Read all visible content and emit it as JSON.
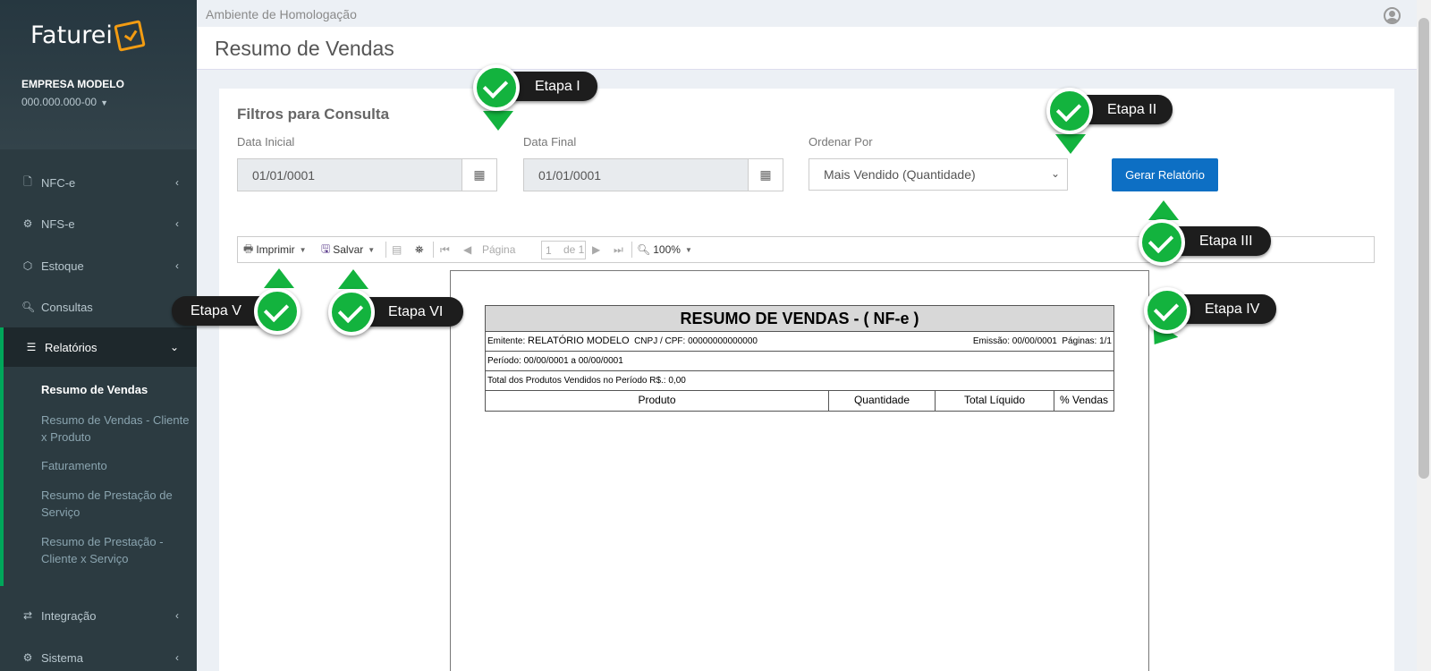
{
  "app": {
    "logo_text": "Faturei",
    "company": "EMPRESA MODELO",
    "cnpj": "000.000.000-00"
  },
  "sidebar": {
    "items": [
      {
        "label": "NFC-e",
        "icon": "file-icon"
      },
      {
        "label": "NFS-e",
        "icon": "cogs-icon"
      },
      {
        "label": "Estoque",
        "icon": "cube-icon"
      },
      {
        "label": "Consultas",
        "icon": "search-icon"
      },
      {
        "label": "Relatórios",
        "icon": "list-icon"
      },
      {
        "label": "Integração",
        "icon": "exchange-icon"
      },
      {
        "label": "Sistema",
        "icon": "cogs-icon"
      }
    ],
    "submenu": [
      "Resumo de Vendas",
      "Resumo de Vendas - Cliente x Produto",
      "Faturamento",
      "Resumo de Prestação de Serviço",
      "Resumo de Prestação - Cliente x Serviço"
    ]
  },
  "topbar": {
    "environment": "Ambiente de Homologação"
  },
  "header": {
    "title": "Resumo de Vendas"
  },
  "filters": {
    "title": "Filtros para Consulta",
    "start_label": "Data Inicial",
    "start_value": "01/01/0001",
    "end_label": "Data Final",
    "end_value": "01/01/0001",
    "order_label": "Ordenar Por",
    "order_value": "Mais Vendido (Quantidade)",
    "generate_label": "Gerar Relatório"
  },
  "toolbar": {
    "print": "Imprimir",
    "save": "Salvar",
    "page_label": "Página",
    "page_value": "1",
    "page_of": "de 1",
    "zoom": "100%"
  },
  "report": {
    "title": "RESUMO DE VENDAS - ( NF-e )",
    "emitente_label": "Emitente:",
    "emitente_value": "RELATÓRIO MODELO",
    "cnpj_label": "CNPJ / CPF:",
    "cnpj_value": "00000000000000",
    "emissao": "Emissão: 00/00/0001",
    "paginas": "Páginas: 1/1",
    "periodo": "Período: 00/00/0001 a 00/00/0001",
    "total": "Total dos Produtos Vendidos no Período R$.: 0,00",
    "columns": [
      "Produto",
      "Quantidade",
      "Total Líquido",
      "% Vendas"
    ]
  },
  "callouts": [
    "Etapa I",
    "Etapa II",
    "Etapa III",
    "Etapa IV",
    "Etapa V",
    "Etapa VI"
  ],
  "colors": {
    "sidebar": "#2c3b41",
    "accent": "#00a65a",
    "button": "#0d6fc4",
    "callout_green": "#13b33e"
  }
}
